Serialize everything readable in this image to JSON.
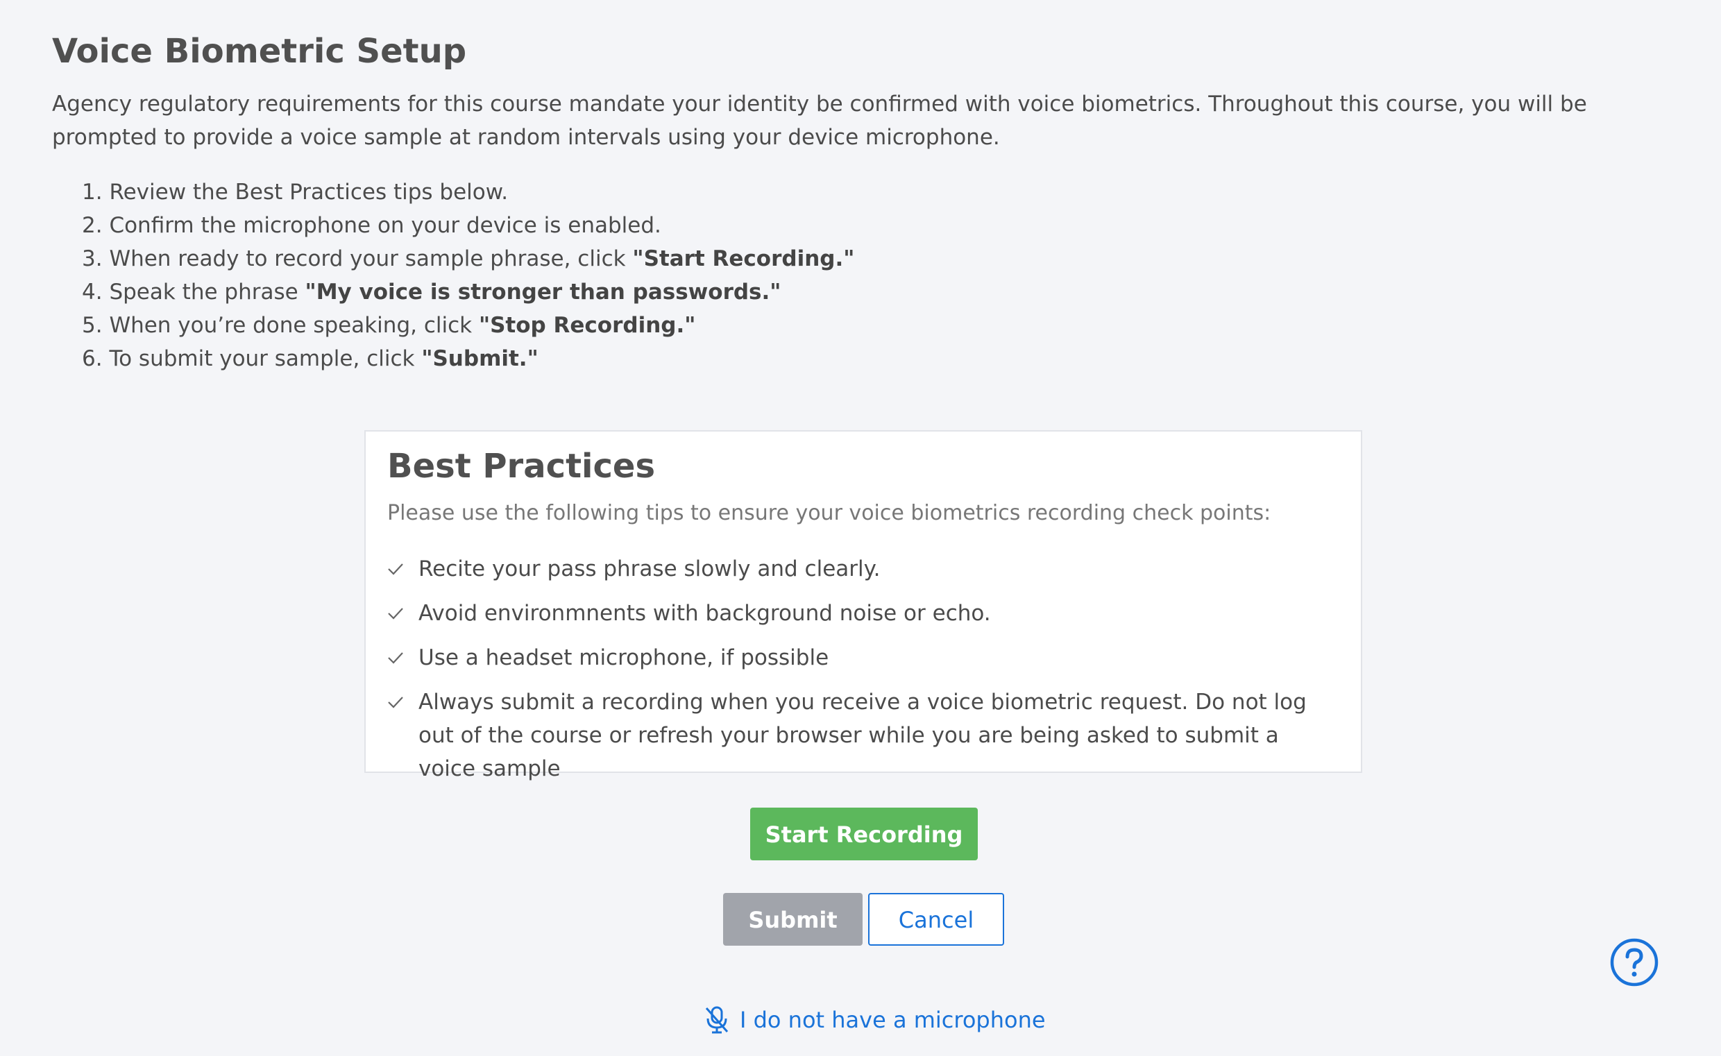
{
  "page": {
    "title": "Voice Biometric Setup",
    "intro": "Agency regulatory requirements for this course mandate your identity be confirmed with voice biometrics. Throughout this course, you will be prompted to provide a voice sample at random intervals using your device microphone."
  },
  "steps": [
    {
      "num": "1.",
      "text": "Review the Best Practices tips below.",
      "bold": ""
    },
    {
      "num": "2.",
      "text": "Confirm the microphone on your device is enabled.",
      "bold": ""
    },
    {
      "num": "3.",
      "text": "When ready to record your sample phrase, click ",
      "bold": "\"Start Recording.\""
    },
    {
      "num": "4.",
      "text": "Speak the phrase ",
      "bold": "\"My voice is stronger than passwords.\""
    },
    {
      "num": "5.",
      "text": "When you’re done speaking, click ",
      "bold": "\"Stop Recording.\""
    },
    {
      "num": "6.",
      "text": "To submit your sample, click ",
      "bold": "\"Submit.\""
    }
  ],
  "best_practices": {
    "title": "Best Practices",
    "subtitle": "Please use the following tips to ensure your voice biometrics recording check points:",
    "tips": [
      "Recite your pass phrase slowly and clearly.",
      "Avoid environmnents with background noise or echo.",
      "Use a headset microphone, if possible",
      "Always submit a recording when you receive a voice biometric request. Do not log out of the course or refresh your browser while you are being asked to submit a voice sample"
    ],
    "tip_icon": "check-icon"
  },
  "actions": {
    "start_recording": "Start Recording",
    "submit": "Submit",
    "cancel": "Cancel",
    "no_microphone": "I do not have a microphone",
    "no_microphone_icon": "microphone-off-icon",
    "help_icon": "help-icon"
  },
  "colors": {
    "background": "#f4f5f8",
    "start_button": "#5cb85c",
    "submit_button_disabled": "#a1a4ab",
    "link_blue": "#1a73d9"
  }
}
